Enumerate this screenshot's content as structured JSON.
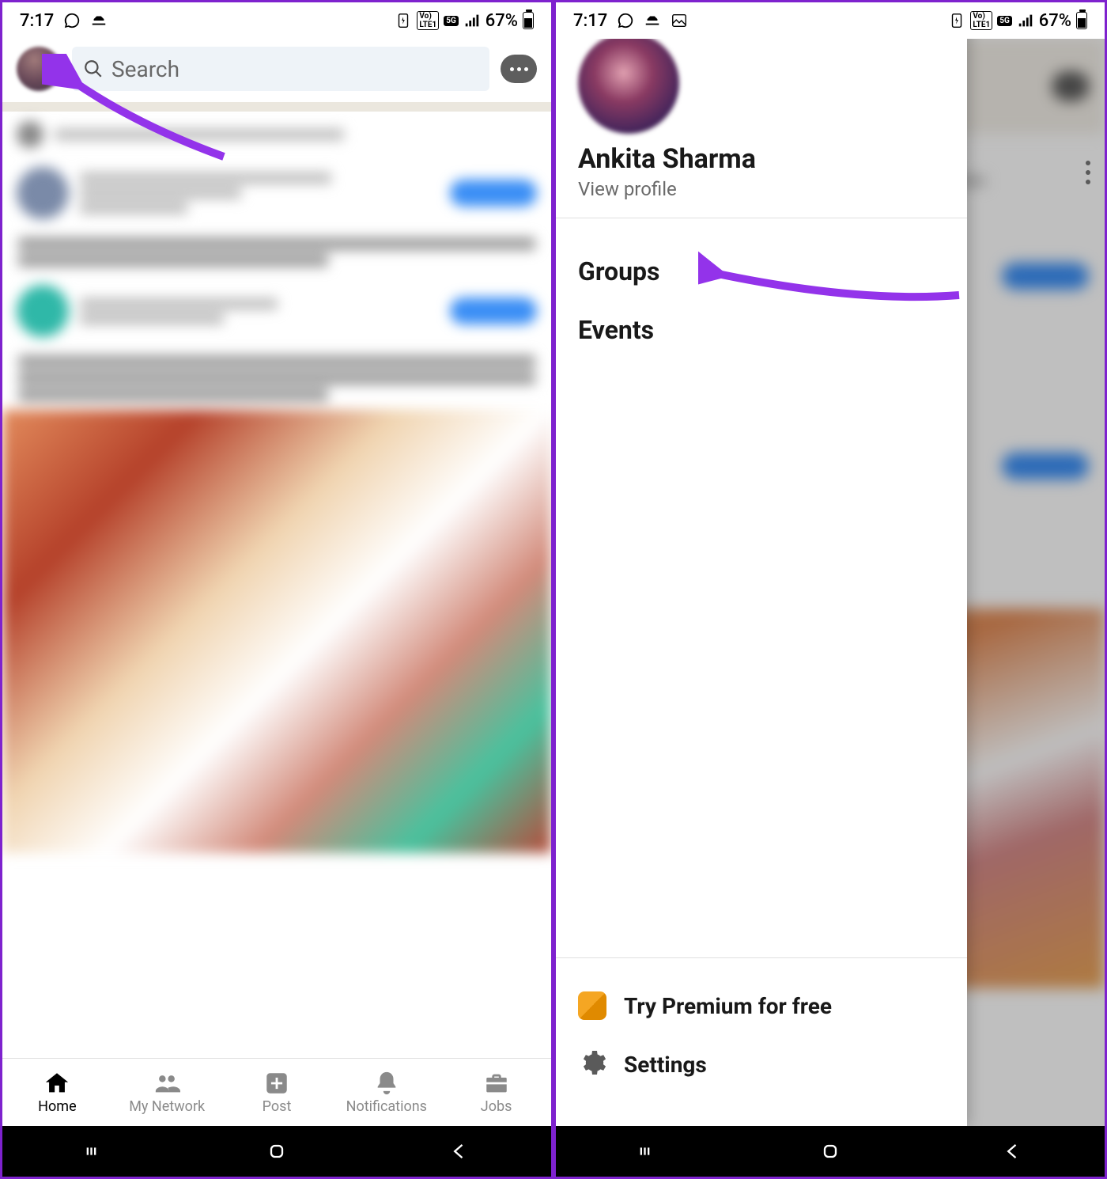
{
  "status": {
    "time": "7:17",
    "battery_text": "67%"
  },
  "header": {
    "search_placeholder": "Search"
  },
  "nav": {
    "home": "Home",
    "network": "My Network",
    "post": "Post",
    "notifications": "Notifications",
    "jobs": "Jobs"
  },
  "drawer": {
    "name": "Ankita Sharma",
    "view_profile": "View profile",
    "groups": "Groups",
    "events": "Events",
    "premium": "Try Premium for free",
    "settings": "Settings"
  }
}
